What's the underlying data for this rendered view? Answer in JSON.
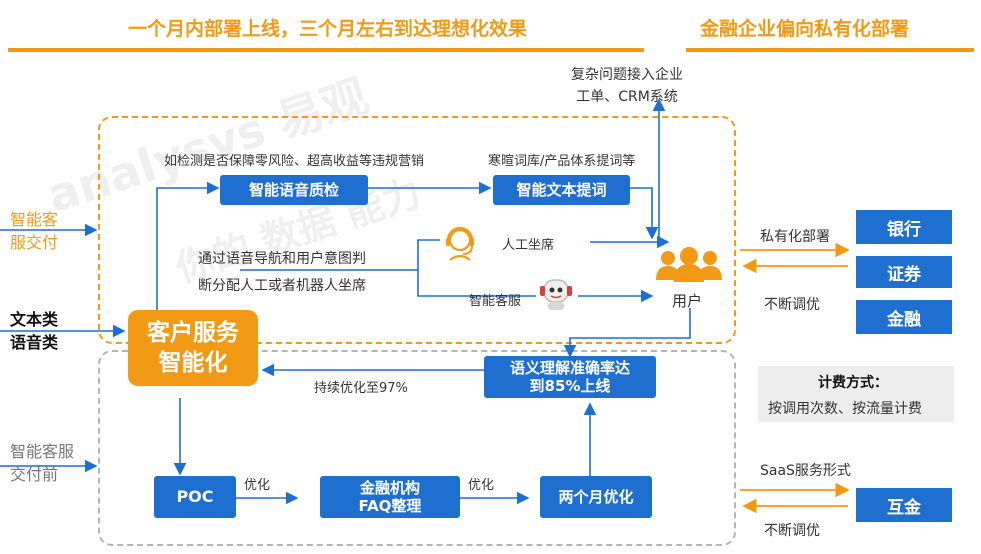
{
  "header": {
    "left_title": "一个月内部署上线，三个月左右到达理想化效果",
    "right_title": "金融企业偏向私有化部署"
  },
  "watermark": {
    "brand": "analysys 易观",
    "slogan": "你的 数据 能力"
  },
  "left_labels": {
    "delivery": [
      "智能客",
      "服交付"
    ],
    "input": [
      "文本类",
      "语音类"
    ],
    "pre_delivery": [
      "智能客服",
      "交付前"
    ]
  },
  "top_annotation": [
    "复杂问题接入企业",
    "工单、CRM系统"
  ],
  "notes": {
    "quality_check": "如检测是否保障零风险、超高收益等违规营销",
    "text_extract": "寒暄词库/产品体系提词等",
    "routing": [
      "通过语音导航和用户意图判",
      "断分配人工或者机器人坐席"
    ],
    "human_agent": "人工坐席",
    "bot_agent": "智能客服",
    "user": "用户",
    "continuous": "持续优化至97%",
    "optimize1": "优化",
    "optimize2": "优化"
  },
  "boxes": {
    "voice_qc": "智能语音质检",
    "text_extract": "智能文本提词",
    "center": [
      "客户服务",
      "智能化"
    ],
    "semantic": [
      "语义理解准确率达",
      "到85%上线"
    ],
    "poc": "POC",
    "faq": [
      "金融机构",
      "FAQ整理"
    ],
    "two_months": "两个月优化"
  },
  "right_panel": {
    "private_label": "私有化部署",
    "tune_label_1": "不断调优",
    "bank": "银行",
    "securities": "证券",
    "finance": "金融",
    "billing_title": "计费方式：",
    "billing_detail": "按调用次数、按流量计费",
    "saas_label": "SaaS服务形式",
    "tune_label_2": "不断调优",
    "hujin": "互金"
  },
  "colors": {
    "orange": "#f29a16",
    "blue": "#1f6fd0",
    "gray_dash": "#b5b5b5",
    "gray_fill": "#ededed"
  }
}
